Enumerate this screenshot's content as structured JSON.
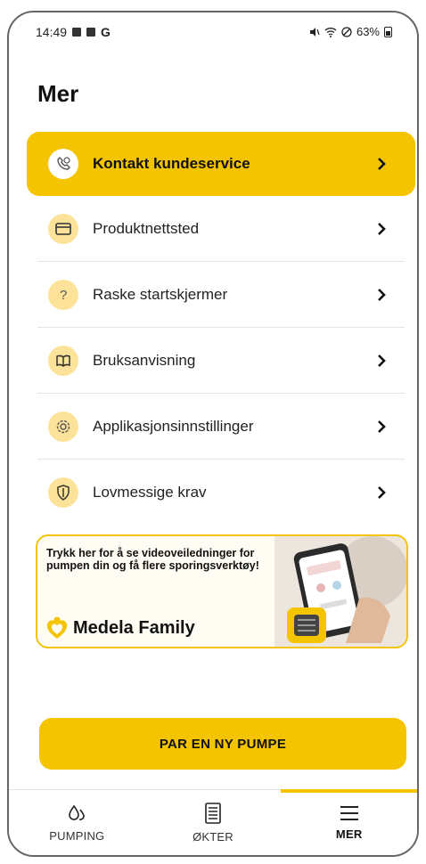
{
  "status_bar": {
    "time": "14:49",
    "extra": "G",
    "battery": "63%"
  },
  "page": {
    "title": "Mer"
  },
  "menu": {
    "items": [
      {
        "label": "Kontakt kundeservice",
        "icon": "phone-chat-icon"
      },
      {
        "label": "Produktnettsted",
        "icon": "browser-window-icon"
      },
      {
        "label": "Raske startskjermer",
        "icon": "question-icon"
      },
      {
        "label": "Bruksanvisning",
        "icon": "book-icon"
      },
      {
        "label": "Applikasjonsinnstillinger",
        "icon": "gear-icon"
      },
      {
        "label": "Lovmessige krav",
        "icon": "shield-icon"
      }
    ]
  },
  "banner": {
    "text": "Trykk her for å se videoveiledninger for pumpen din og få flere sporingsverktøy!",
    "brand": "Medela Family"
  },
  "primary_button": {
    "label": "PAR EN NY PUMPE"
  },
  "bottom_nav": {
    "tabs": [
      {
        "label": "PUMPING",
        "icon": "droplets-icon"
      },
      {
        "label": "ØKTER",
        "icon": "list-document-icon"
      },
      {
        "label": "MER",
        "icon": "menu-icon",
        "active": true
      }
    ]
  },
  "colors": {
    "accent": "#f5c400",
    "icon_bg": "#fde39a"
  }
}
